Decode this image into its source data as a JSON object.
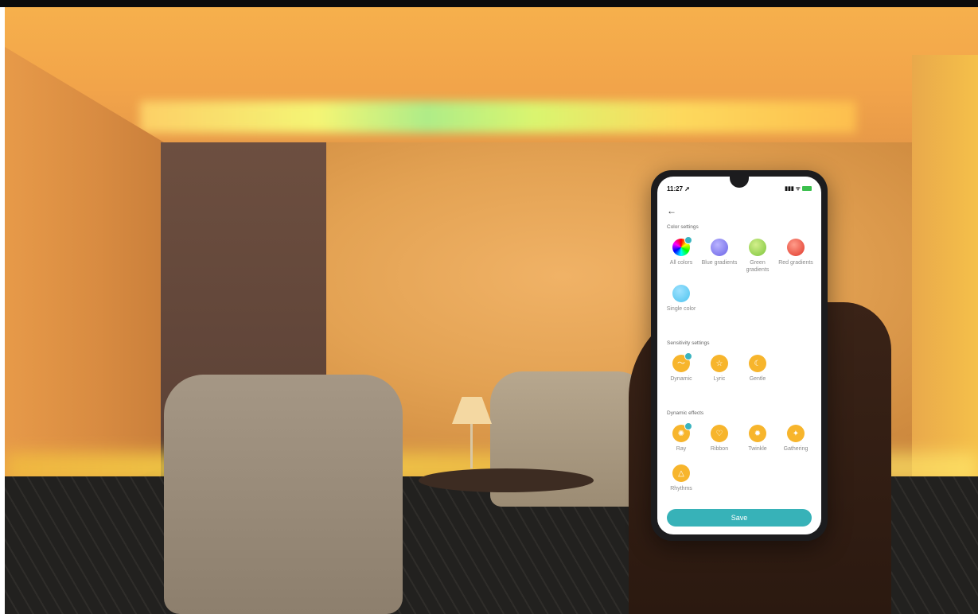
{
  "status": {
    "time": "11:27 ➚",
    "icons": "▮▮▮ ᯤ"
  },
  "colors": {
    "accent": "#37b2b8",
    "effect_orange": "#f7b52c"
  },
  "sections": {
    "color_settings": {
      "title": "Color settings",
      "options": [
        {
          "label": "All colors",
          "selected": true
        },
        {
          "label": "Blue gradients"
        },
        {
          "label": "Green gradients"
        },
        {
          "label": "Red gradients"
        },
        {
          "label": "Single color"
        }
      ]
    },
    "sensitivity_settings": {
      "title": "Sensitivity settings",
      "options": [
        {
          "label": "Dynamic",
          "selected": true,
          "icon": "wave-icon"
        },
        {
          "label": "Lyric",
          "icon": "star-icon"
        },
        {
          "label": "Gentle",
          "icon": "moon-icon"
        }
      ]
    },
    "dynamic_effects": {
      "title": "Dynamic effects",
      "options": [
        {
          "label": "Ray",
          "selected": true,
          "icon": "ray-icon"
        },
        {
          "label": "Ribbon",
          "icon": "heart-icon"
        },
        {
          "label": "Twinkle",
          "icon": "sparkle-icon"
        },
        {
          "label": "Gathering",
          "icon": "gathering-icon"
        },
        {
          "label": "Rhythms",
          "icon": "rhythm-icon"
        }
      ]
    }
  },
  "save_label": "Save"
}
